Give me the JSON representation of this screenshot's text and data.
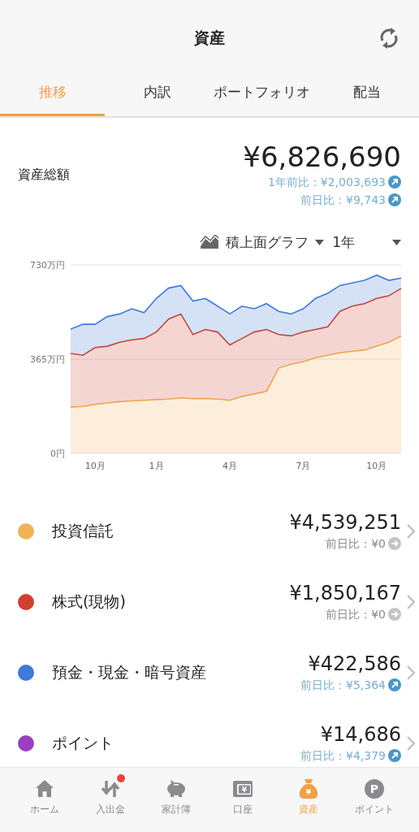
{
  "header": {
    "title": "資産"
  },
  "tabs": [
    {
      "label": "推移",
      "selected": true
    },
    {
      "label": "内訳",
      "selected": false
    },
    {
      "label": "ポートフォリオ",
      "selected": false
    },
    {
      "label": "配当",
      "selected": false
    }
  ],
  "total": {
    "label": "資産総額",
    "amount": "¥6,826,690",
    "changes": [
      {
        "text": "1年前比：¥2,003,693",
        "kind": "up"
      },
      {
        "text": "前日比：¥9,743",
        "kind": "up"
      }
    ]
  },
  "chart_controls": {
    "type_select": "積上面グラフ",
    "period_select": "1年"
  },
  "chart_data": {
    "type": "area",
    "stacked": true,
    "categories": [
      null,
      null,
      "10月",
      null,
      null,
      null,
      null,
      "1月",
      null,
      null,
      null,
      null,
      null,
      "4月",
      null,
      null,
      null,
      null,
      null,
      "7月",
      null,
      null,
      null,
      null,
      null,
      "10月",
      null,
      null
    ],
    "series": [
      {
        "color": "#f0b35a",
        "values": [
          179,
          182,
          190,
          195,
          200,
          203,
          205,
          208,
          210,
          215,
          212,
          212,
          210,
          205,
          220,
          230,
          240,
          330,
          345,
          355,
          370,
          380,
          390,
          395,
          400,
          415,
          430,
          454
        ]
      },
      {
        "color": "#d0402f",
        "values": [
          208,
          198,
          220,
          220,
          230,
          237,
          240,
          262,
          310,
          325,
          248,
          268,
          260,
          215,
          225,
          240,
          240,
          130,
          110,
          115,
          110,
          110,
          160,
          175,
          180,
          185,
          180,
          185
        ]
      },
      {
        "color": "#3f7ad6",
        "values": [
          94,
          120,
          90,
          115,
          110,
          120,
          100,
          130,
          120,
          110,
          130,
          120,
          100,
          120,
          125,
          90,
          100,
          90,
          85,
          90,
          120,
          130,
          100,
          90,
          90,
          90,
          60,
          40
        ]
      }
    ],
    "ylim": [
      0,
      730
    ],
    "yticks": [
      {
        "value": 0,
        "label": "0円"
      },
      {
        "value": 365,
        "label": "365万円"
      },
      {
        "value": 730,
        "label": "730万円"
      }
    ]
  },
  "assets": [
    {
      "name": "投資信託",
      "color": "#f0b35a",
      "amount": "¥4,539,251",
      "change": "前日比：¥0",
      "kind": "flat"
    },
    {
      "name": "株式(現物)",
      "color": "#d0402f",
      "amount": "¥1,850,167",
      "change": "前日比：¥0",
      "kind": "flat"
    },
    {
      "name": "預金・現金・暗号資産",
      "color": "#3f7ad6",
      "amount": "¥422,586",
      "change": "前日比：¥5,364",
      "kind": "up"
    },
    {
      "name": "ポイント",
      "color": "#9a3fc0",
      "amount": "¥14,686",
      "change": "前日比：¥4,379",
      "kind": "up"
    }
  ],
  "nav": [
    {
      "label": "ホーム",
      "kind": "home",
      "selected": false,
      "badge": false
    },
    {
      "label": "入出金",
      "kind": "transfer",
      "selected": false,
      "badge": true
    },
    {
      "label": "家計簿",
      "kind": "piggy",
      "selected": false,
      "badge": false
    },
    {
      "label": "口座",
      "kind": "wallet",
      "glyph": "¥",
      "selected": false,
      "badge": false
    },
    {
      "label": "資産",
      "kind": "moneybag",
      "glyph": "¥",
      "selected": true,
      "badge": false
    },
    {
      "label": "ポイント",
      "kind": "point",
      "glyph": "P",
      "selected": false,
      "badge": false
    }
  ]
}
